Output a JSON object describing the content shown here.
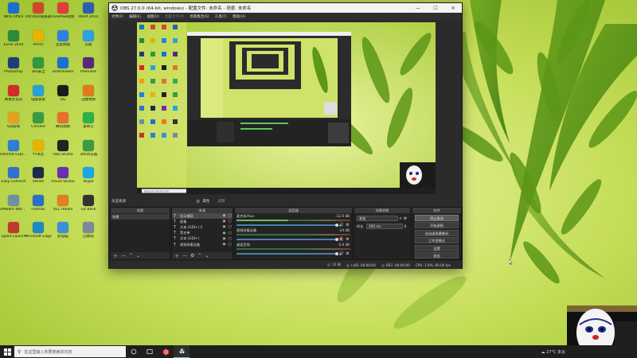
{
  "desktop": {
    "icons": [
      {
        "label": "WPS Office",
        "color": "#1b6fd1"
      },
      {
        "label": "UltraISO软碟通",
        "color": "#d04a2a"
      },
      {
        "label": "FonePaw视频",
        "color": "#e23c3c"
      },
      {
        "label": "Word 2010",
        "color": "#2b5fb3"
      },
      {
        "label": "Excel 2010",
        "color": "#2a8a3e"
      },
      {
        "label": "Pencil",
        "color": "#e6b400"
      },
      {
        "label": "百度网盘",
        "color": "#2f80e3"
      },
      {
        "label": "迅雷",
        "color": "#2f9fe6"
      },
      {
        "label": "Photoshop",
        "color": "#1c3f7a"
      },
      {
        "label": "360安全",
        "color": "#2f9a3e"
      },
      {
        "label": "TeamViewer",
        "color": "#1c6fd4"
      },
      {
        "label": "Premiere",
        "color": "#5a2a7a"
      },
      {
        "label": "网易云音乐",
        "color": "#d42a2a"
      },
      {
        "label": "电脑管家",
        "color": "#2aa0d8"
      },
      {
        "label": "QQ",
        "color": "#1b1b1b"
      },
      {
        "label": "迅捷视频",
        "color": "#e07a1e"
      },
      {
        "label": "QQ游戏",
        "color": "#e5a21f"
      },
      {
        "label": "Chrome",
        "color": "#3a9b45"
      },
      {
        "label": "腾讯视频",
        "color": "#e6722a"
      },
      {
        "label": "爱奇艺",
        "color": "#2bb24c"
      },
      {
        "label": "Internet Explorer",
        "color": "#2b7fd8"
      },
      {
        "label": "YY语音",
        "color": "#e6b400"
      },
      {
        "label": "OBS Studio",
        "color": "#222222"
      },
      {
        "label": "360浏览器",
        "color": "#3a9b45"
      },
      {
        "label": "Easy Connect",
        "color": "#2f6fd6"
      },
      {
        "label": "Steam",
        "color": "#1b2b4a"
      },
      {
        "label": "Visual Studio",
        "color": "#6a2fb0"
      },
      {
        "label": "Skype",
        "color": "#1aa7e6"
      },
      {
        "label": "VMware Workstation",
        "color": "#6d8fa8"
      },
      {
        "label": "Foxmail",
        "color": "#2a6fc9"
      },
      {
        "label": "VLC media",
        "color": "#e67e22"
      },
      {
        "label": "Git Bash",
        "color": "#333333"
      },
      {
        "label": "Spore Launch",
        "color": "#c0392b"
      },
      {
        "label": "Microsoft Edge",
        "color": "#1e88c8"
      },
      {
        "label": "此电脑",
        "color": "#3b8fd8"
      },
      {
        "label": "回收站",
        "color": "#7a8a9a"
      }
    ]
  },
  "obs": {
    "title": "OBS 27.0.0 (64-bit, windows) - 配置文件: 未命名 - 场景: 未命名",
    "menu": [
      "文件(F)",
      "编辑(E)",
      "视图(V)",
      "配置文件(P)",
      "场景集合(S)",
      "工具(T)",
      "帮助(H)"
    ],
    "menu_dim_index": 3,
    "toolbar_row": {
      "scene_label": "未选择源",
      "properties": "属性",
      "filters": "滤镜"
    },
    "scenes": {
      "title": "场景",
      "items": [
        "场景"
      ]
    },
    "sources": {
      "title": "来源",
      "items": [
        {
          "icon": "T",
          "name": "显示捕获"
        },
        {
          "icon": "T",
          "name": "图像"
        },
        {
          "icon": "T",
          "name": "文本 (GDI+) 2"
        },
        {
          "icon": "T",
          "name": "黑名单"
        },
        {
          "icon": "T",
          "name": "文本 (GDI+)"
        },
        {
          "icon": "T",
          "name": "视频采集设备"
        }
      ]
    },
    "mixer": {
      "title": "混音器",
      "tracks": [
        {
          "name": "麦克风/Aux",
          "db": "-12.0 dB",
          "muted": false,
          "level": 0.45
        },
        {
          "name": "视频采集设备",
          "db": "-inf dB",
          "muted": true,
          "level": 0
        },
        {
          "name": "桌面音频",
          "db": "0.0 dB",
          "muted": false,
          "level": 0
        }
      ]
    },
    "transitions": {
      "title": "场景转换",
      "type": "渐变",
      "duration_label": "时长",
      "duration": "300 ms"
    },
    "controls": {
      "title": "控件",
      "buttons": [
        "停止推流",
        "开始录制",
        "启动虚拟摄像机",
        "工作室模式",
        "设置",
        "退出"
      ],
      "active_index": 0
    },
    "status": {
      "live_label": "LIVE: 00:00:00",
      "rec_label": "REC: 00:00:00",
      "cpu_label": "CPU: 1.8%, 60.00 fps",
      "dropped": "12 帧"
    },
    "preview_url": "jiaoxue.kkcnf.com"
  },
  "taskbar": {
    "search_placeholder": "在这里输入你要搜索的内容",
    "weather": "27°C",
    "weather_desc": "多云",
    "apps": [
      "task-view",
      "edge",
      "netease-music",
      "obs"
    ]
  },
  "colors": {
    "obs_bg": "#2b2b2b",
    "taskbar": "#1f1f1f",
    "wallpaper_base": "#b9d24a"
  }
}
